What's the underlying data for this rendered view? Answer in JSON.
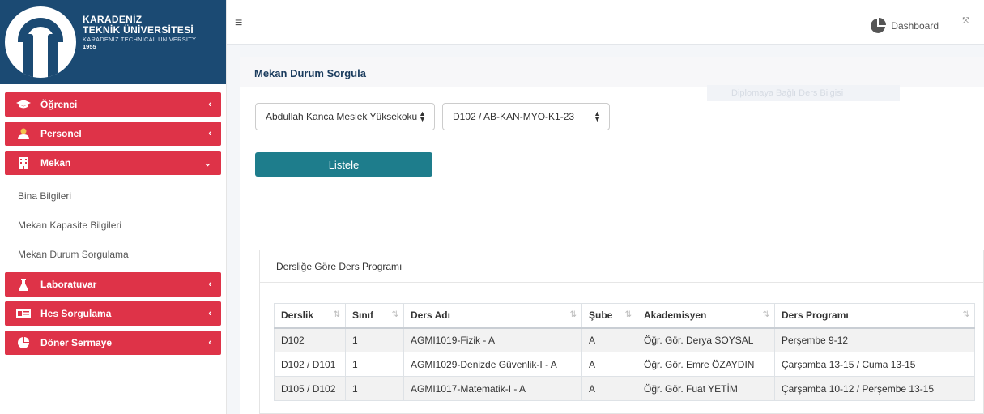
{
  "brand": {
    "line1": "KARADENİZ",
    "line2": "TEKNİK ÜNİVERSİTESİ",
    "line3": "KARADENİZ TECHNICAL UNIVERSITY",
    "line4": "1955"
  },
  "sidebar": {
    "items": [
      {
        "label": "Öğrenci",
        "icon": "graduation-cap-icon",
        "chevron": "‹"
      },
      {
        "label": "Personel",
        "icon": "users-icon",
        "chevron": "‹"
      },
      {
        "label": "Mekan",
        "icon": "building-icon",
        "chevron": "⌄"
      }
    ],
    "submenu": [
      "Bina Bilgileri",
      "Mekan Kapasite Bilgileri",
      "Mekan Durum Sorgulama"
    ],
    "items_after": [
      {
        "label": "Laboratuvar",
        "icon": "flask-icon",
        "chevron": "‹"
      },
      {
        "label": "Hes Sorgulama",
        "icon": "id-card-icon",
        "chevron": "‹"
      },
      {
        "label": "Döner Sermaye",
        "icon": "pie-chart-icon",
        "chevron": "‹"
      }
    ]
  },
  "topbar": {
    "menu_icon": "≡",
    "dashboard_label": "Dashboard",
    "expand_icon": "⤧"
  },
  "page": {
    "title": "Mekan Durum Sorgula",
    "ghost_text": "Diplomaya Bağlı Ders Bilgisi"
  },
  "filters": {
    "school_value": "Abdullah Kanca Meslek Yüksekoku",
    "room_value": "D102 / AB-KAN-MYO-K1-23",
    "list_button": "Listele"
  },
  "schedule": {
    "title": "Dersliğe Göre Ders Programı",
    "columns": [
      "Derslik",
      "Sınıf",
      "Ders Adı",
      "Şube",
      "Akademisyen",
      "Ders Programı"
    ],
    "rows": [
      [
        "D102",
        "1",
        "AGMI1019-Fizik - A",
        "A",
        "Öğr. Gör. Derya SOYSAL",
        "Perşembe 9-12"
      ],
      [
        "D102 / D101",
        "1",
        "AGMI1029-Denizde Güvenlik-I - A",
        "A",
        "Öğr. Gör. Emre ÖZAYDIN",
        "Çarşamba 13-15 / Cuma 13-15"
      ],
      [
        "D105 / D102",
        "1",
        "AGMI1017-Matematik-I - A",
        "A",
        "Öğr. Gör. Fuat YETİM",
        "Çarşamba 10-12 / Perşembe 13-15"
      ]
    ]
  },
  "colors": {
    "brand_blue": "#1b4a73",
    "menu_red": "#de3348",
    "button_teal": "#1e7d8c"
  }
}
